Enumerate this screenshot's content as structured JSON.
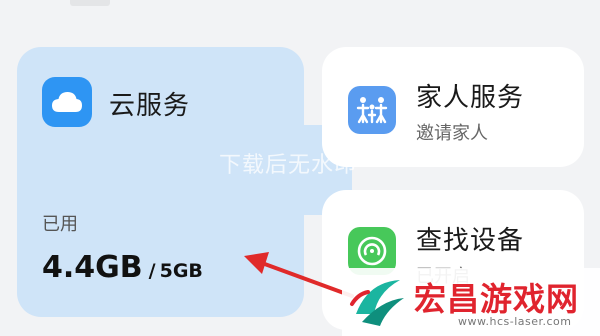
{
  "cloud_card": {
    "title": "云服务",
    "used_label": "已用",
    "used": "4.4GB",
    "separator": "/",
    "total": "5GB",
    "accent": "#2e95f3"
  },
  "family_card": {
    "title": "家人服务",
    "subtitle": "邀请家人",
    "accent": "#5a9cf0"
  },
  "find_card": {
    "title": "查找设备",
    "subtitle": "已开启",
    "accent": "#47c85a"
  },
  "watermark": {
    "text": "下载后无水印"
  },
  "site_logo": {
    "name": "宏昌游戏网",
    "url": "www.hcs-laser.com"
  },
  "annotation": {
    "arrow_color": "#e02a2a"
  }
}
